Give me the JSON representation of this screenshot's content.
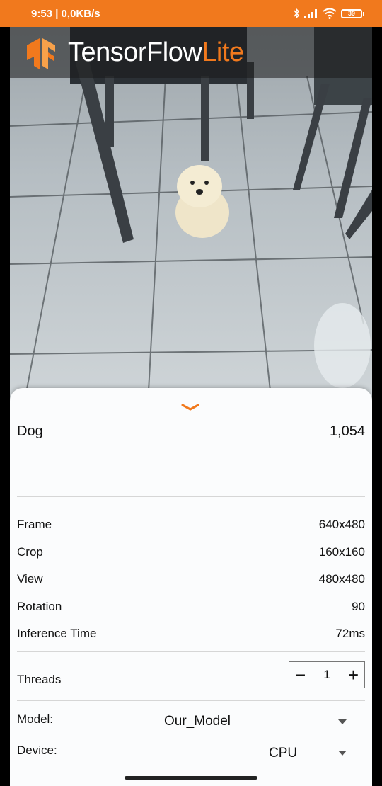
{
  "status_bar": {
    "time": "9:53 | 0,0KB/s",
    "battery": "39"
  },
  "app": {
    "brand_main": "TensorFlow",
    "brand_accent": "Lite",
    "accent_color": "#f1791d"
  },
  "result": {
    "label": "Dog",
    "score": "1,054"
  },
  "info": [
    {
      "label": "Frame",
      "value": "640x480"
    },
    {
      "label": "Crop",
      "value": "160x160"
    },
    {
      "label": "View",
      "value": "480x480"
    },
    {
      "label": "Rotation",
      "value": "90"
    },
    {
      "label": "Inference Time",
      "value": "72ms"
    }
  ],
  "threads": {
    "label": "Threads",
    "value": "1",
    "minus": "−",
    "plus": "+"
  },
  "model": {
    "label": "Model:",
    "value": "Our_Model"
  },
  "device": {
    "label": "Device:",
    "value": "CPU"
  }
}
